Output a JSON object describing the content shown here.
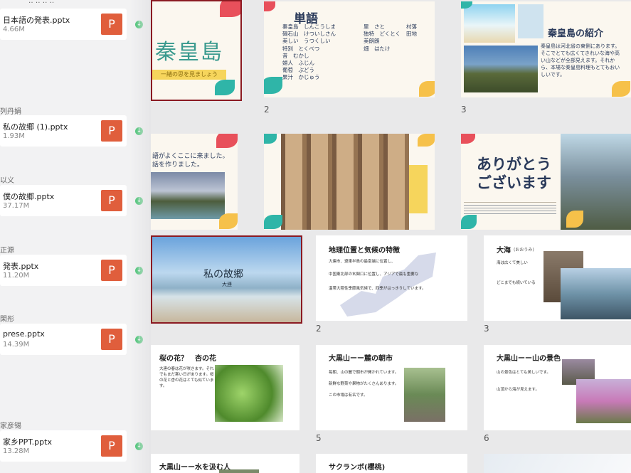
{
  "left_panel": {
    "files": [
      {
        "name": "日本語の発表.pptx",
        "size": "4.66M"
      },
      {
        "name": "私の故郷 (1).pptx",
        "size": "1.93M"
      },
      {
        "name": "僕の故郷.pptx",
        "size": "37.17M"
      },
      {
        "name": "発表.pptx",
        "size": "11.20M"
      },
      {
        "name": "prese.pptx",
        "size": "14.39M"
      },
      {
        "name": "家乡PPT.pptx",
        "size": "13.28M"
      }
    ],
    "senders": [
      "列丹娟",
      "以义",
      "正源",
      "閑彤",
      "家彦锡"
    ],
    "icon_letter": "P",
    "colors": {
      "ppt": "#e05e3c",
      "download": "#1db954"
    }
  },
  "slides_row1": {
    "s1_title": "秦皇島",
    "s1_sub": "一緒の思を見ましょう",
    "s2_title": "単語",
    "s2_words": [
      "秦皇島　しんこうしま",
      "碣石山　けついしさん",
      "美しい　うつくしい",
      "特別　とくべつ",
      "昔　むかし",
      "婦人　ふじん",
      "葡萄　ぶどう",
      "果汁　かじゅう"
    ],
    "s2_words_b": [
      "里　さと",
      "独特　どくとく",
      "美朗朗",
      "畑　はたけ"
    ],
    "s2_words_c": [
      "村落",
      "",
      "田地",
      ""
    ],
    "s3_title": "秦皇島の紹介",
    "s3_body": "秦皇島は河北省の東側にあります。そこでとても広くてきれいな海や高い山などが全部見えます。それから、本場な秦皇島料理もとてもおいしいです。",
    "num2": "2",
    "num3": "3"
  },
  "slides_row2": {
    "s4_text_1": "語がよくここに来ました。",
    "s4_text_2": "話を作りました。",
    "s6_title": "ありがとうございます"
  },
  "slides_row3": {
    "s7_title": "私の故郷",
    "s7_sub": "大連",
    "s8_title": "地理位置と気候の特徴",
    "s8_b1": "大連市、遼東半島の最南端に位置し、",
    "s8_b2": "中国東北部の玄関口に位置し、アジアで最も重要な",
    "s8_b3": "温帯大陸性季節風気候で、四季がはっきりしています。",
    "s9_title": "大海",
    "s9_sub": "(おおうみ)",
    "s9_b1": "海は広くて美しい",
    "s9_b2": "どこまでも続いている",
    "num_a": "2",
    "num_b": "3"
  },
  "slides_row4": {
    "s10_title": "桜の花？　杏の花",
    "s10_body": "大連の春は花が咲きます。それでもまだ寒い日があります。桜の花と杏の花はとても似ています。",
    "s11_title": "大黒山ーー麓の朝市",
    "s11_b1": "毎朝、山の麓で朝市が開かれています。",
    "s11_b2": "新鮮な野菜や果物がたくさんあります。",
    "s11_b3": "この市場は有名です。",
    "s12_title": "大黒山ーー山の景色",
    "s12_b1": "山の景色はとても美しいです。",
    "s12_b2": "山頂から海が見えます。",
    "num5": "5",
    "num6": "6"
  },
  "slides_row5": {
    "s13_title": "大黒山ーー水を汲む人",
    "s14_title": "サクランボ(櫻桃)"
  }
}
